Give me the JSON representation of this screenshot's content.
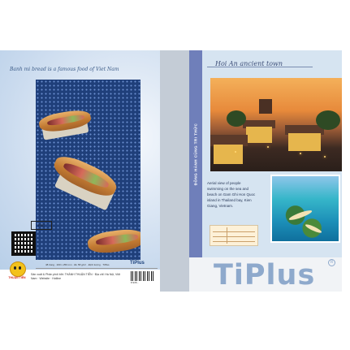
{
  "back_cover": {
    "title": "Banh mi bread is a famous food of Viet Nam",
    "fsc_label": "FSC",
    "specs_row": "48 trang  ·  200 x 250 mm  ·  ĐL 58 g/m²  ·  Định lượng  ·  TiPlus",
    "mascot_label": "THUẬN TIẾN",
    "maker_text": "Sản xuất & Phân phối bởi: THÀNH THUẬN TIẾN · Địa chỉ: Hà Nội, Việt Nam · Website · Hotline",
    "brand_small": "TiPlus",
    "barcode_number": "8 935..."
  },
  "spine": {},
  "front_cover": {
    "title": "Hoi An ancient town",
    "stripe_text": "ĐỒNG HÀNH CÙNG TRI THỨC",
    "aerial_text": "Aerial view of people swimming on the sea and beach on Gam Ghi Hon Quoc island in Thailand bay, Kien Giang, Vietnam.",
    "logo": "TiPlus",
    "registered": "R"
  }
}
